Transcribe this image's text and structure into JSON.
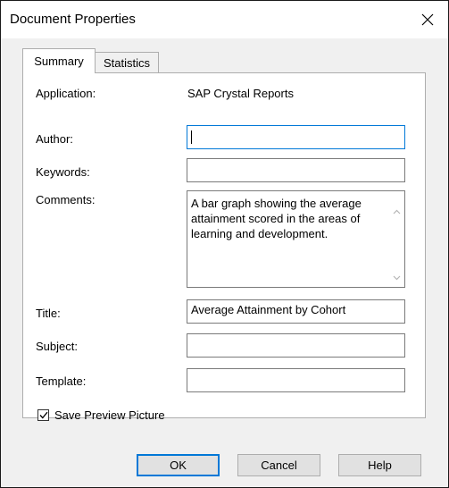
{
  "window": {
    "title": "Document Properties"
  },
  "tabs": [
    {
      "label": "Summary"
    },
    {
      "label": "Statistics"
    }
  ],
  "summary": {
    "application_label": "Application:",
    "application_value": "SAP Crystal Reports",
    "author_label": "Author:",
    "author_value": "",
    "keywords_label": "Keywords:",
    "keywords_value": "",
    "comments_label": "Comments:",
    "comments_value": "A bar graph showing the average attainment scored in the areas of learning and development.",
    "title_label": "Title:",
    "title_value": "Average Attainment by Cohort",
    "subject_label": "Subject:",
    "subject_value": "",
    "template_label": "Template:",
    "template_value": "",
    "save_preview_label": "Save Preview Picture",
    "save_preview_checked": true
  },
  "buttons": {
    "ok": "OK",
    "cancel": "Cancel",
    "help": "Help"
  },
  "colors": {
    "focus_border": "#0078d7",
    "dialog_bg": "#f0f0f0",
    "button_bg": "#e1e1e1"
  },
  "icons": {
    "close": "close-icon",
    "check": "check-icon",
    "scroll_up": "scroll-up-arrow-icon",
    "scroll_down": "scroll-down-arrow-icon"
  }
}
